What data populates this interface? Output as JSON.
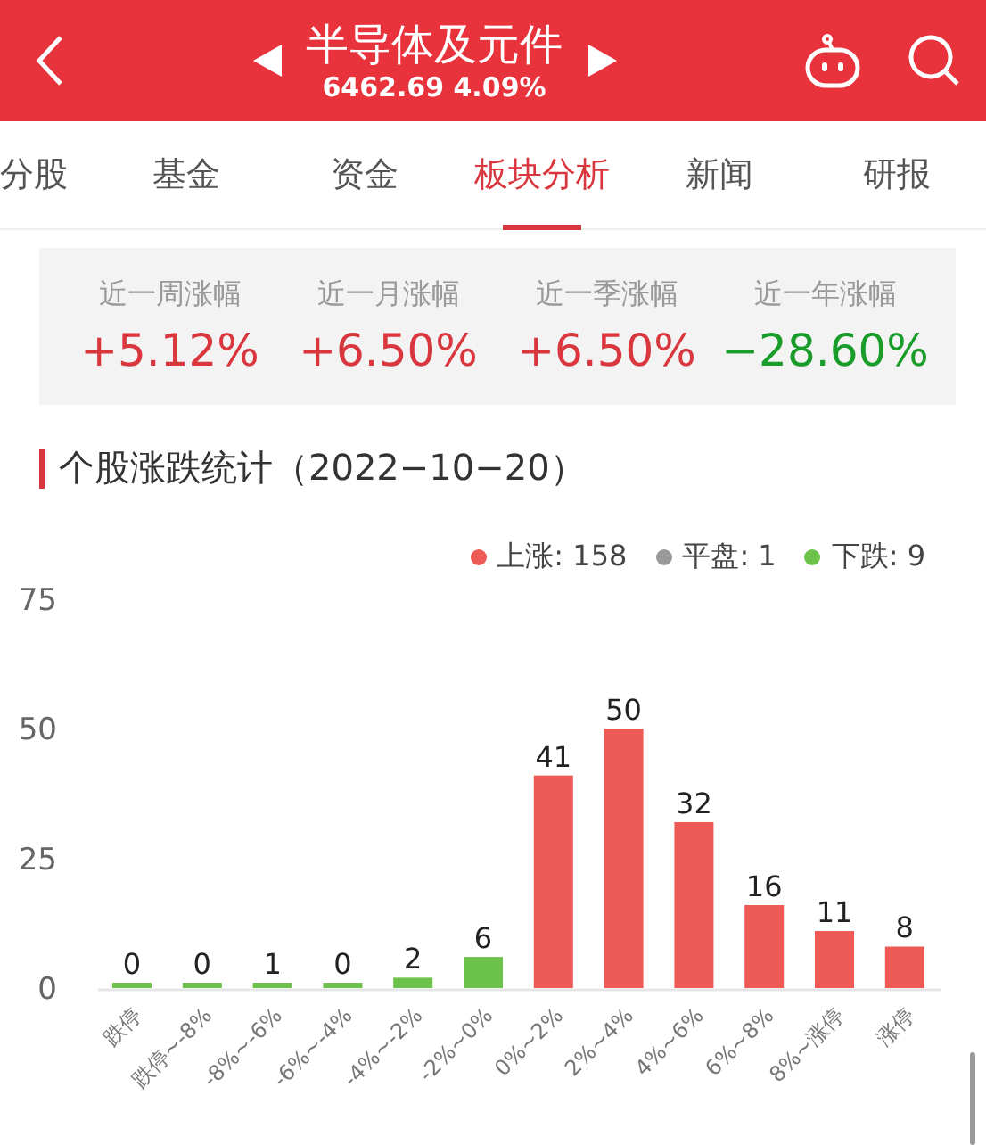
{
  "header": {
    "title": "半导体及元件",
    "quote": "6462.69 4.09%"
  },
  "tabs": [
    {
      "label": "分股",
      "selected": false
    },
    {
      "label": "基金",
      "selected": false
    },
    {
      "label": "资金",
      "selected": false
    },
    {
      "label": "板块分析",
      "selected": true
    },
    {
      "label": "新闻",
      "selected": false
    },
    {
      "label": "研报",
      "selected": false
    }
  ],
  "stats": [
    {
      "label": "近一周涨幅",
      "value": "+5.12%",
      "color": "#d9363e"
    },
    {
      "label": "近一月涨幅",
      "value": "+6.50%",
      "color": "#d9363e"
    },
    {
      "label": "近一季涨幅",
      "value": "+6.50%",
      "color": "#d9363e"
    },
    {
      "label": "近一年涨幅",
      "value": "−28.60%",
      "color": "#1a9c2a"
    }
  ],
  "section_title": "个股涨跌统计（2022−10−20）",
  "legend": [
    {
      "label": "上涨: 158",
      "color": "#ee5a55"
    },
    {
      "label": "平盘: 1",
      "color": "#999999"
    },
    {
      "label": "下跌: 9",
      "color": "#6cc24a"
    }
  ],
  "chart_data": {
    "type": "bar",
    "stacked": true,
    "ylim": [
      0,
      75
    ],
    "yticks": [
      0,
      25,
      50,
      75
    ],
    "data_labels": true,
    "categories": [
      "跌停",
      "跌停~-8%",
      "-8%~-6%",
      "-6%~-4%",
      "-4%~-2%",
      "-2%~0%",
      "0%~2%",
      "2%~4%",
      "4%~6%",
      "6%~8%",
      "8%~涨停",
      "涨停"
    ],
    "series": [
      {
        "color": "#6cc24a",
        "values": [
          0,
          0,
          1,
          0,
          2,
          6,
          null,
          null,
          null,
          null,
          null,
          null
        ]
      },
      {
        "color": "#ee5a55",
        "values": [
          null,
          null,
          null,
          null,
          null,
          null,
          41,
          50,
          32,
          16,
          11,
          8
        ]
      }
    ]
  }
}
